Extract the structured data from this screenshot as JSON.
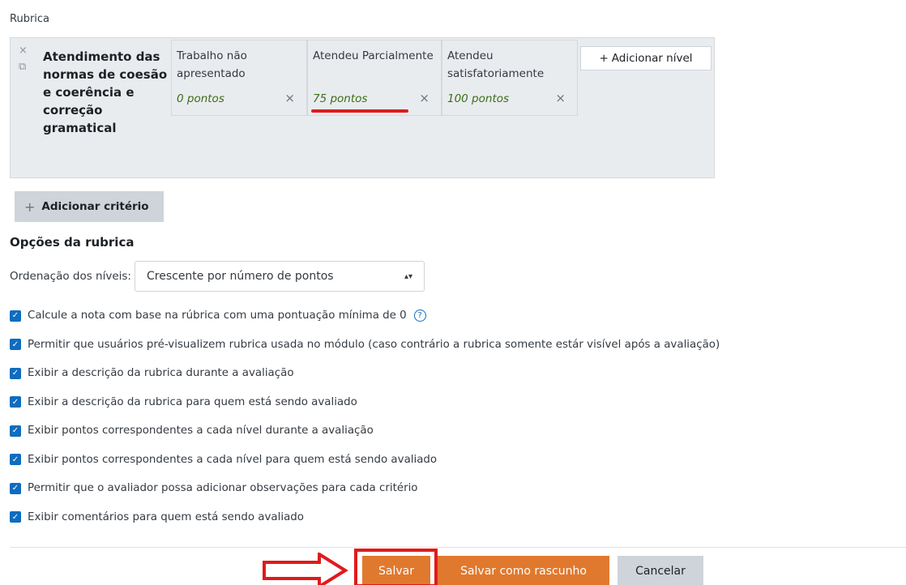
{
  "rubric": {
    "title": "Rubrica",
    "criterion": {
      "delete_glyph": "×",
      "move_glyph": "⧉",
      "description": "Atendimento das normas de coesão e coerência e correção gramatical"
    },
    "levels": [
      {
        "definition": "Trabalho não apresentado",
        "score": "0 pontos"
      },
      {
        "definition": "Atendeu Parcialmente",
        "score": "75 pontos"
      },
      {
        "definition": "Atendeu satisfatoriamente",
        "score": "100 pontos"
      }
    ],
    "add_level_label": "Adicionar nível",
    "add_criterion_label": "Adicionar critério"
  },
  "options": {
    "title": "Opções da rubrica",
    "sort_label": "Ordenação dos níveis:",
    "sort_value": "Crescente por número de pontos",
    "items": [
      {
        "label": "Calcule a nota com base na rúbrica com uma pontuação mínima de 0",
        "checked": true
      },
      {
        "label": "Permitir que usuários pré-visualizem rubrica usada no módulo (caso contrário a rubrica somente estár visível após a avaliação)",
        "checked": true
      },
      {
        "label": "Exibir a descrição da rubrica durante a avaliação",
        "checked": true
      },
      {
        "label": "Exibir a descrição da rubrica para quem está sendo avaliado",
        "checked": true
      },
      {
        "label": "Exibir pontos correspondentes a cada nível durante a avaliação",
        "checked": true
      },
      {
        "label": "Exibir pontos correspondentes a cada nível para quem está sendo avaliado",
        "checked": true
      },
      {
        "label": "Permitir que o avaliador possa adicionar observações para cada critério",
        "checked": true
      },
      {
        "label": "Exibir comentários para quem está sendo avaliado",
        "checked": true
      }
    ]
  },
  "buttons": {
    "save": "Salvar",
    "save_draft": "Salvar como rascunho",
    "cancel": "Cancelar"
  },
  "colors": {
    "accent": "#0f6cbf",
    "primary_button": "#e0792d",
    "annotation": "#e01b1b",
    "score_text": "#3c6e16"
  },
  "icons": {
    "delete": "close-icon",
    "move": "move-icon",
    "help": "help-icon",
    "add": "plus-icon",
    "checkbox": "check-icon",
    "arrow": "arrow-right-icon"
  }
}
